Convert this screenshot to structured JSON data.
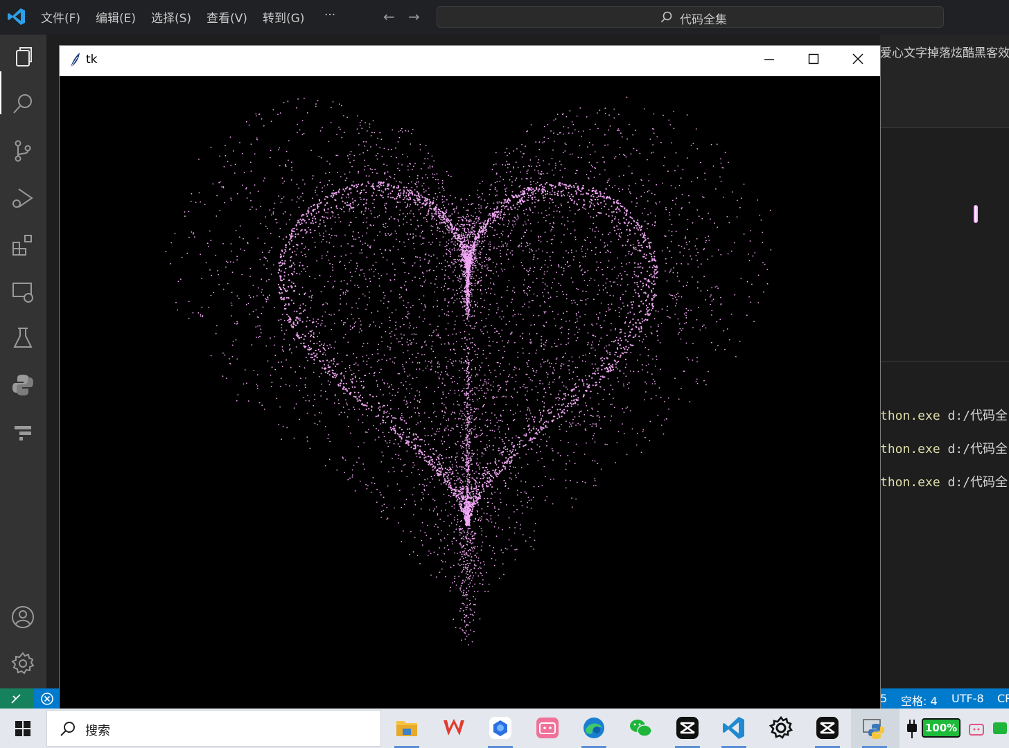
{
  "vscode": {
    "menu": [
      "文件(F)",
      "编辑(E)",
      "选择(S)",
      "查看(V)",
      "转到(G)",
      "···"
    ],
    "command_center": "代码全集",
    "tab_title": "爱心文字掉落炫酷黑客效",
    "terminal_lines": [
      {
        "exe": "thon.exe",
        "path": " d:/代码全"
      },
      {
        "exe": "thon.exe",
        "path": " d:/代码全"
      },
      {
        "exe": "thon.exe",
        "path": " d:/代码全"
      }
    ],
    "status": {
      "item_5": "5",
      "spaces": "空格: 4",
      "encoding": "UTF-8",
      "eol": "CR"
    }
  },
  "tk_window": {
    "title": "tk",
    "heart_color": "#f0a6f5",
    "background": "#000000"
  },
  "taskbar": {
    "search_placeholder": "搜索",
    "apps": [
      "file-explorer-icon",
      "wps-icon",
      "baidu-netdisk-icon",
      "bilibili-icon",
      "edge-icon",
      "wechat-icon",
      "capcut-icon",
      "vscode-icon",
      "settings-icon",
      "capcut-icon",
      "python-icon"
    ],
    "battery": "100%"
  }
}
